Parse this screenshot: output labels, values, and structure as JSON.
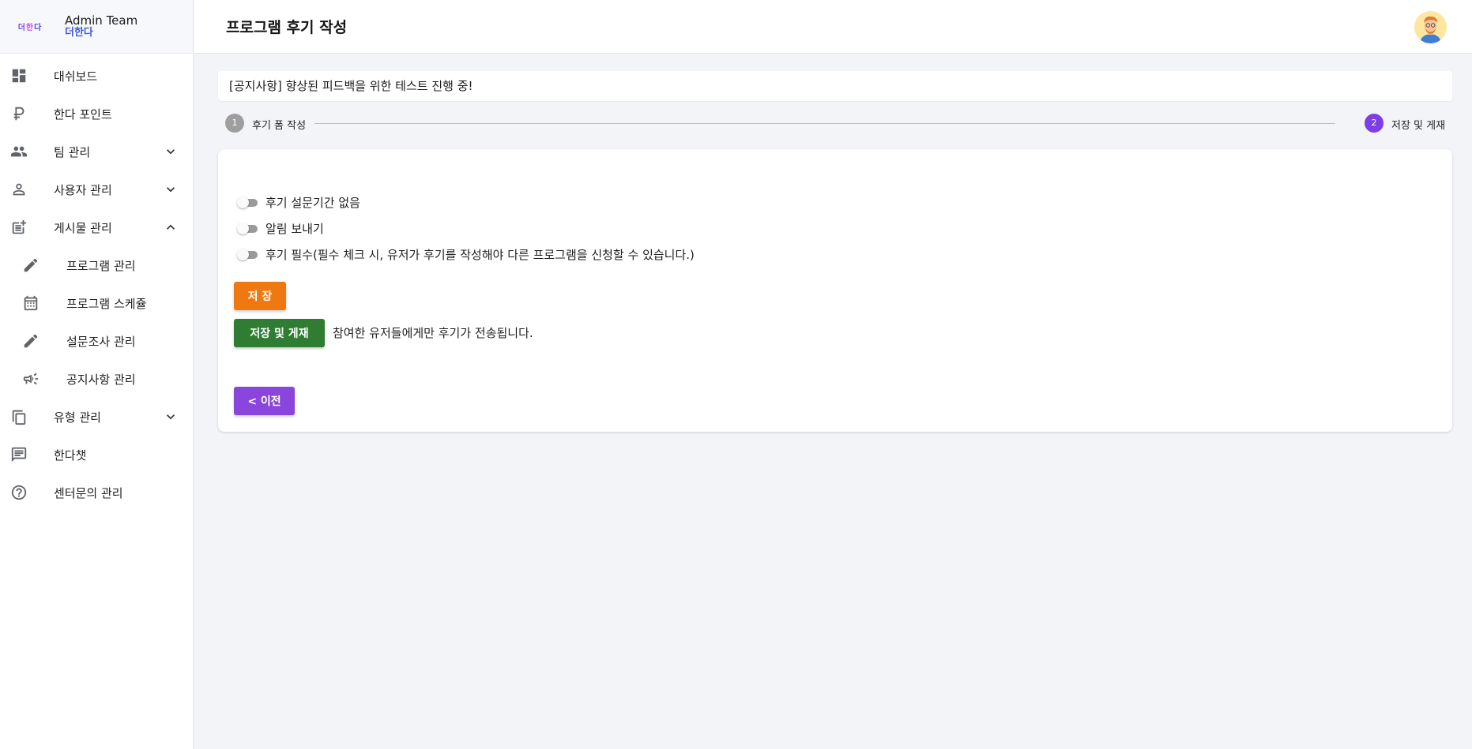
{
  "brand": {
    "logo_text": [
      "더",
      "한",
      "다"
    ],
    "title": "Admin Team",
    "subtitle": "더한다"
  },
  "sidebar": {
    "items": [
      {
        "label": "대쉬보드",
        "icon": "dashboard-icon"
      },
      {
        "label": "한다 포인트",
        "icon": "ruble-icon"
      },
      {
        "label": "팀 관리",
        "icon": "people-icon",
        "chevron": "down"
      },
      {
        "label": "사용자 관리",
        "icon": "person-icon",
        "chevron": "down"
      },
      {
        "label": "게시물 관리",
        "icon": "post-add-icon",
        "chevron": "up"
      },
      {
        "label": "프로그램 관리",
        "icon": "pencil-icon",
        "sub": true
      },
      {
        "label": "프로그램 스케쥴",
        "icon": "calendar-icon",
        "sub": true
      },
      {
        "label": "설문조사 관리",
        "icon": "pencil-icon",
        "sub": true
      },
      {
        "label": "공지사항 관리",
        "icon": "megaphone-icon",
        "sub": true
      },
      {
        "label": "유형 관리",
        "icon": "copy-icon",
        "chevron": "down"
      },
      {
        "label": "한다챗",
        "icon": "chat-icon"
      },
      {
        "label": "센터문의 관리",
        "icon": "help-icon"
      }
    ]
  },
  "header": {
    "title": "프로그램 후기 작성"
  },
  "notice": {
    "text": "[공지사항] 향상된 피드백을 위한 테스트 진행 중!"
  },
  "stepper": {
    "steps": [
      {
        "number": "1",
        "label": "후기 폼 작성",
        "state": "completed"
      },
      {
        "number": "2",
        "label": "저장 및 게재",
        "state": "active"
      }
    ]
  },
  "form": {
    "toggles": [
      {
        "label": "후기 설문기간 없음",
        "checked": false
      },
      {
        "label": "알림 보내기",
        "checked": false
      },
      {
        "label": "후기 필수(필수 체크 시, 유저가 후기를 작성해야 다른 프로그램을 신청할 수 있습니다.)",
        "checked": false
      }
    ],
    "save_label": "저 장",
    "publish_label": "저장 및 게재",
    "publish_note": "참여한 유저들에게만 후기가 전송됩니다.",
    "prev_label": "< 이전"
  },
  "colors": {
    "accent": "#7b3fe4",
    "save": "#f07810",
    "publish": "#2e7d32",
    "prev": "#8a45dc",
    "brand_sub": "#3d5ad8"
  }
}
